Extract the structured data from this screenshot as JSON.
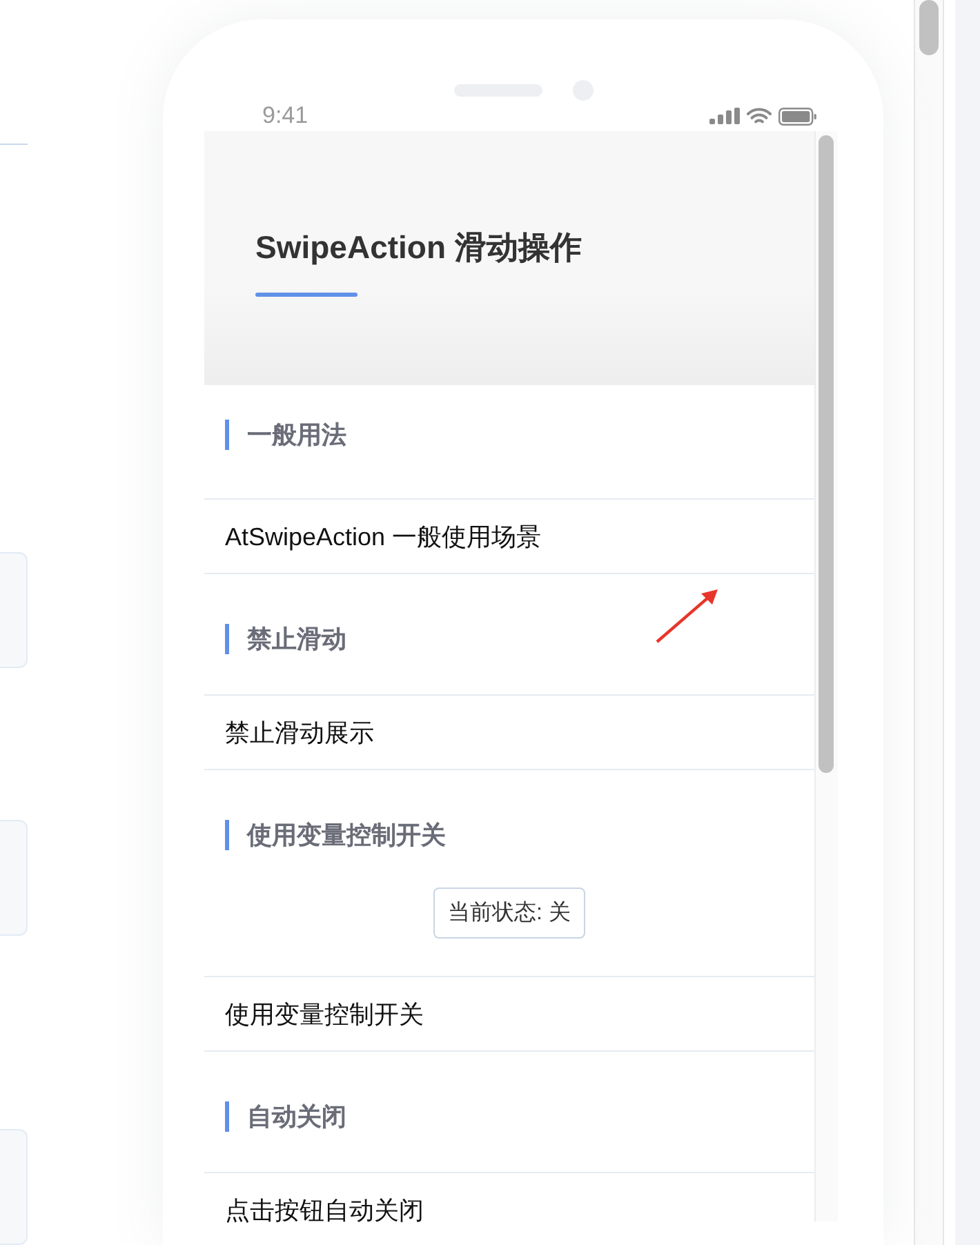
{
  "status_bar": {
    "time": "9:41"
  },
  "header": {
    "title": "SwipeAction 滑动操作"
  },
  "sections": [
    {
      "title": "一般用法",
      "items": [
        "AtSwipeAction 一般使用场景"
      ]
    },
    {
      "title": "禁止滑动",
      "items": [
        "禁止滑动展示"
      ]
    },
    {
      "title": "使用变量控制开关",
      "status_button": {
        "label": "当前状态: 关"
      },
      "items": [
        "使用变量控制开关"
      ]
    },
    {
      "title": "自动关闭",
      "items": [
        "点击按钮自动关闭"
      ]
    }
  ]
}
